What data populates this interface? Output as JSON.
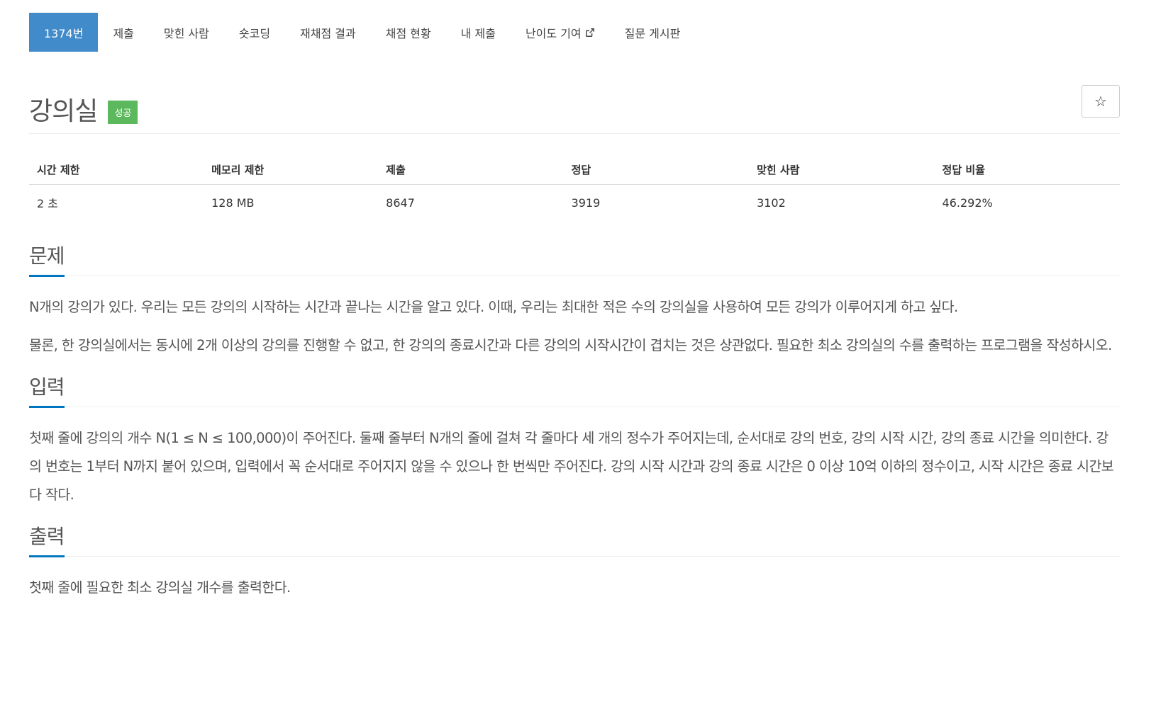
{
  "nav": {
    "items": [
      {
        "label": "1374번",
        "active": true
      },
      {
        "label": "제출"
      },
      {
        "label": "맞힌 사람"
      },
      {
        "label": "숏코딩"
      },
      {
        "label": "재채점 결과"
      },
      {
        "label": "채점 현황"
      },
      {
        "label": "내 제출"
      },
      {
        "label": "난이도 기여",
        "icon": "external-link-icon"
      },
      {
        "label": "질문 게시판"
      }
    ]
  },
  "problem": {
    "title": "강의실",
    "badge": "성공",
    "star_icon": "☆"
  },
  "info": {
    "headers": [
      "시간 제한",
      "메모리 제한",
      "제출",
      "정답",
      "맞힌 사람",
      "정답 비율"
    ],
    "values": [
      "2 초",
      "128 MB",
      "8647",
      "3919",
      "3102",
      "46.292%"
    ]
  },
  "sections": {
    "problem": {
      "title": "문제",
      "p1": "N개의 강의가 있다. 우리는 모든 강의의 시작하는 시간과 끝나는 시간을 알고 있다. 이때, 우리는 최대한 적은 수의 강의실을 사용하여 모든 강의가 이루어지게 하고 싶다.",
      "p2": "물론, 한 강의실에서는 동시에 2개 이상의 강의를 진행할 수 없고, 한 강의의 종료시간과 다른 강의의 시작시간이 겹치는 것은 상관없다. 필요한 최소 강의실의 수를 출력하는 프로그램을 작성하시오."
    },
    "input": {
      "title": "입력",
      "p1": "첫째 줄에 강의의 개수 N(1 ≤ N ≤ 100,000)이 주어진다. 둘째 줄부터 N개의 줄에 걸쳐 각 줄마다 세 개의 정수가 주어지는데, 순서대로 강의 번호, 강의 시작 시간, 강의 종료 시간을 의미한다. 강의 번호는 1부터 N까지 붙어 있으며, 입력에서 꼭 순서대로 주어지지 않을 수 있으나 한 번씩만 주어진다. 강의 시작 시간과 강의 종료 시간은 0 이상 10억 이하의 정수이고, 시작 시간은 종료 시간보다 작다."
    },
    "output": {
      "title": "출력",
      "p1": "첫째 줄에 필요한 최소 강의실 개수를 출력한다."
    }
  },
  "colors": {
    "active_tab": "#428bca",
    "badge": "#5cb85c",
    "section_underline": "#0076c0"
  }
}
